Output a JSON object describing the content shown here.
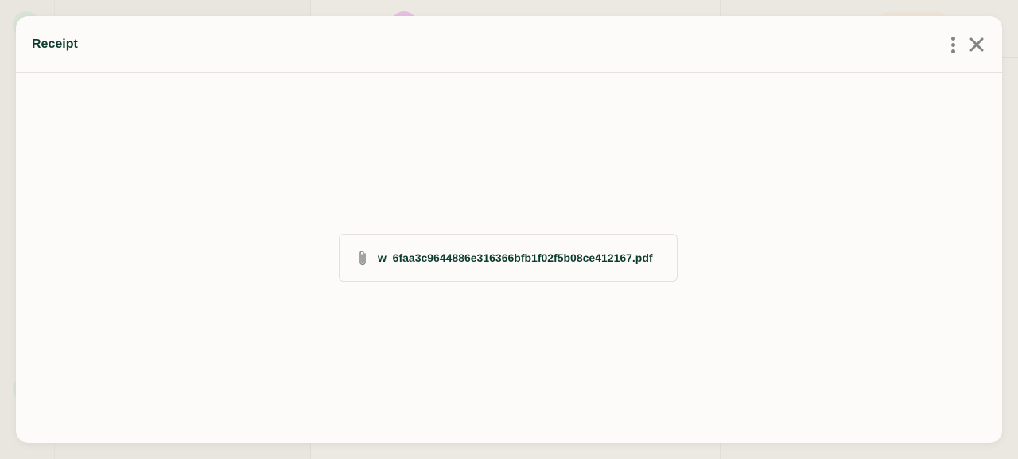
{
  "modal": {
    "title": "Receipt",
    "more_icon": "more-vertical-icon",
    "close_icon": "close-icon"
  },
  "attachment": {
    "icon": "paperclip-icon",
    "file_name": "w_6faa3c9644886e316366bfb1f02f5b08ce412167.pdf"
  },
  "colors": {
    "title_text": "#0d3b2e",
    "icon_gray": "#7f8583",
    "modal_bg": "#fcfbf9",
    "backdrop": "#ebe7e1"
  }
}
